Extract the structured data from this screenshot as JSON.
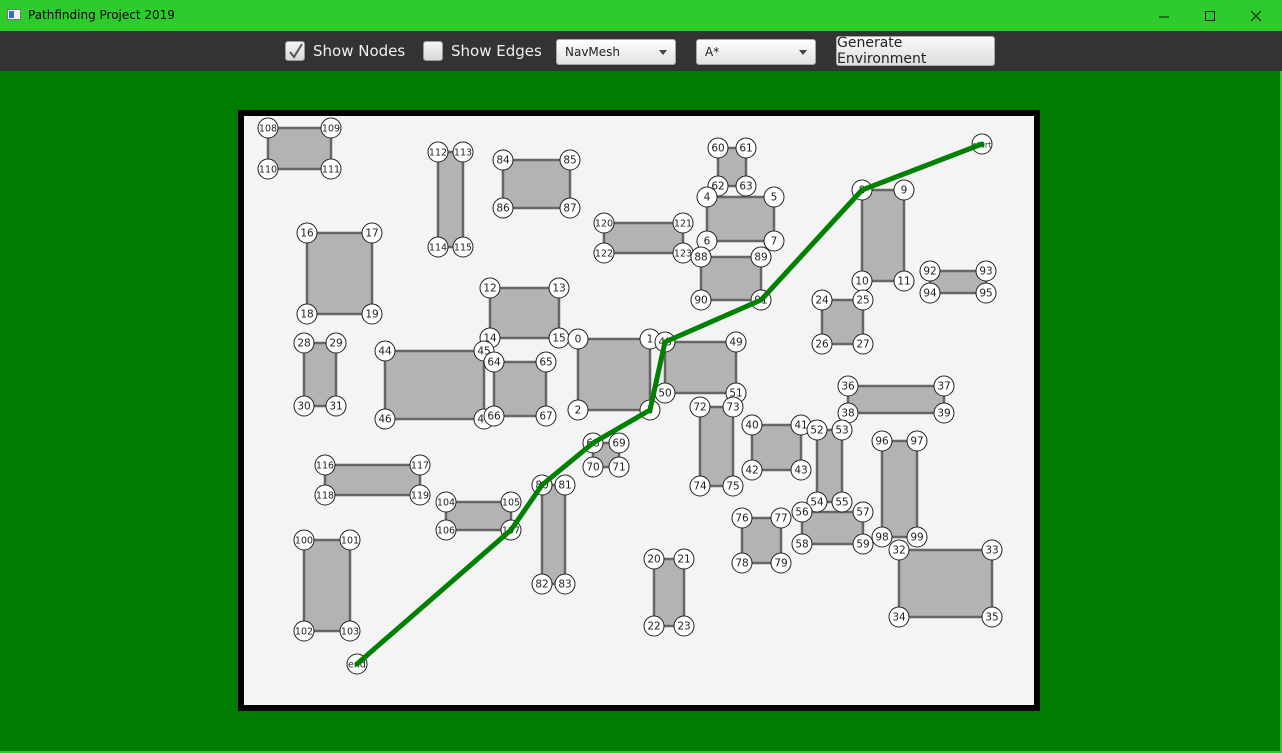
{
  "window": {
    "title": "Pathfinding Project 2019",
    "controls": {
      "minimize": "–",
      "maximize": "☐",
      "close": "✕"
    }
  },
  "toolbar": {
    "show_nodes": {
      "label": "Show Nodes",
      "checked": true
    },
    "show_edges": {
      "label": "Show Edges",
      "checked": false
    },
    "graph_type": {
      "selected": "NavMesh"
    },
    "algorithm": {
      "selected": "A*"
    },
    "generate_label": "Generate Environment"
  },
  "colors": {
    "title_bar": "#2bcc2b",
    "toolbar": "#333333",
    "background": "#007c00",
    "canvas": "#f4f4f4",
    "obstacle_fill": "#b3b3b3",
    "obstacle_stroke": "#666666",
    "path": "#008000"
  },
  "scene": {
    "obstacles": [
      {
        "corners": [
          "108",
          "109",
          "110",
          "111"
        ]
      },
      {
        "corners": [
          "112",
          "113",
          "114",
          "115"
        ]
      },
      {
        "corners": [
          "84",
          "85",
          "86",
          "87"
        ]
      },
      {
        "corners": [
          "60",
          "61",
          "62",
          "63"
        ]
      },
      {
        "corners": [
          "4",
          "5",
          "6",
          "7"
        ]
      },
      {
        "corners": [
          "120",
          "121",
          "122",
          "123"
        ]
      },
      {
        "corners": [
          "88",
          "89",
          "90",
          "91"
        ]
      },
      {
        "corners": [
          "8",
          "9",
          "10",
          "11"
        ]
      },
      {
        "corners": [
          "92",
          "93",
          "94",
          "95"
        ]
      },
      {
        "corners": [
          "24",
          "25",
          "26",
          "27"
        ]
      },
      {
        "corners": [
          "16",
          "17",
          "18",
          "19"
        ]
      },
      {
        "corners": [
          "12",
          "13",
          "14",
          "15"
        ]
      },
      {
        "corners": [
          "28",
          "29",
          "30",
          "31"
        ]
      },
      {
        "corners": [
          "44",
          "45",
          "46",
          "47"
        ]
      },
      {
        "corners": [
          "64",
          "65",
          "66",
          "67"
        ]
      },
      {
        "corners": [
          "0",
          "1",
          "2",
          "3"
        ]
      },
      {
        "corners": [
          "48",
          "49",
          "50",
          "51"
        ]
      },
      {
        "corners": [
          "72",
          "73",
          "74",
          "75"
        ]
      },
      {
        "corners": [
          "36",
          "37",
          "38",
          "39"
        ]
      },
      {
        "corners": [
          "40",
          "41",
          "42",
          "43"
        ]
      },
      {
        "corners": [
          "52",
          "53",
          "54",
          "55"
        ]
      },
      {
        "corners": [
          "96",
          "97",
          "98",
          "99"
        ]
      },
      {
        "corners": [
          "68",
          "69",
          "70",
          "71"
        ]
      },
      {
        "corners": [
          "116",
          "117",
          "118",
          "119"
        ]
      },
      {
        "corners": [
          "104",
          "105",
          "106",
          "107"
        ]
      },
      {
        "corners": [
          "80",
          "81",
          "82",
          "83"
        ]
      },
      {
        "corners": [
          "76",
          "77",
          "78",
          "79"
        ]
      },
      {
        "corners": [
          "56",
          "57",
          "58",
          "59"
        ]
      },
      {
        "corners": [
          "32",
          "33",
          "34",
          "35"
        ]
      },
      {
        "corners": [
          "100",
          "101",
          "102",
          "103"
        ]
      },
      {
        "corners": [
          "20",
          "21",
          "22",
          "23"
        ]
      }
    ],
    "path": [
      "start",
      "8",
      "91",
      "48",
      "3",
      "68",
      "80",
      "107",
      "end"
    ],
    "start_label": "start",
    "end_label": "end"
  }
}
